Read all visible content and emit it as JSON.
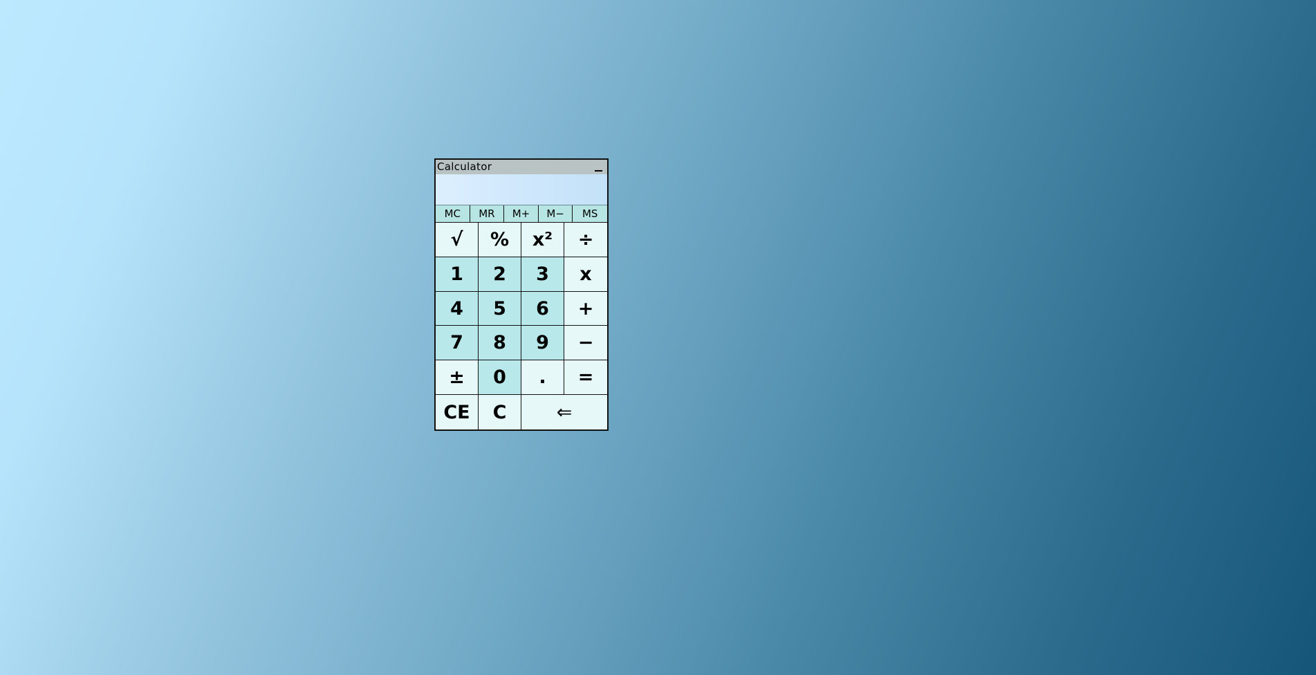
{
  "window": {
    "title": "Calculator",
    "minimize_icon": "minimize-icon"
  },
  "display": {
    "value": ""
  },
  "memory": {
    "buttons": [
      "MC",
      "MR",
      "M+",
      "M−",
      "MS"
    ]
  },
  "keypad": {
    "row1": [
      "√",
      "%",
      "x²",
      "÷"
    ],
    "row2": [
      "1",
      "2",
      "3",
      "x"
    ],
    "row3": [
      "4",
      "5",
      "6",
      "+"
    ],
    "row4": [
      "7",
      "8",
      "9",
      "−"
    ],
    "row5": [
      "±",
      "0",
      ".",
      "="
    ],
    "row6": [
      "CE",
      "C",
      "⇐"
    ]
  },
  "colors": {
    "titlebar": "#b9c3c3",
    "number_key": "#b8e8ea",
    "function_key": "#e6f8f8",
    "memory_row": "#b6e5e3"
  }
}
